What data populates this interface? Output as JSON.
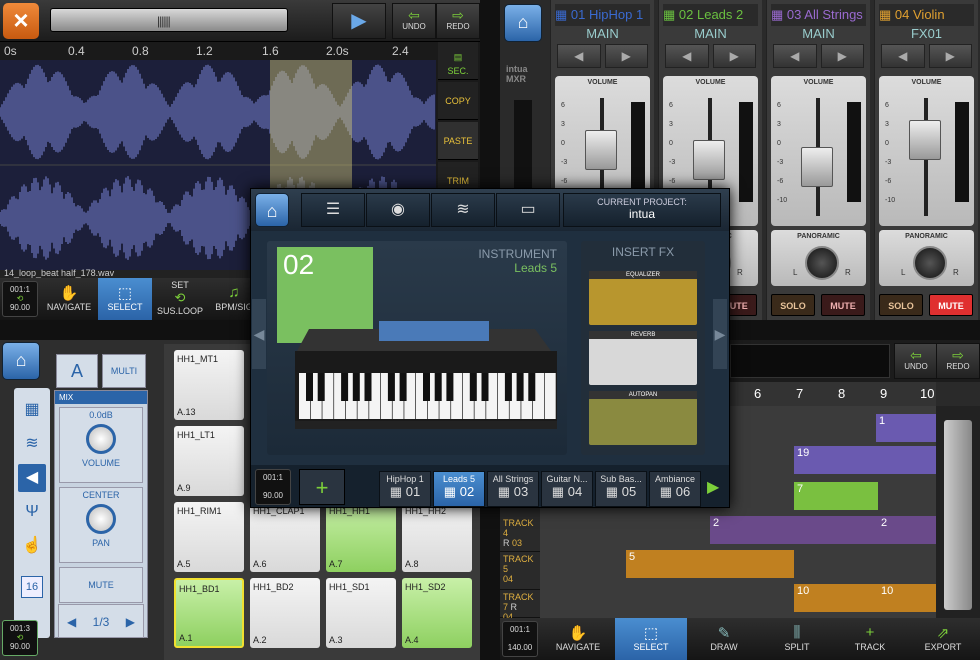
{
  "wave": {
    "close_label": "×",
    "scrubber_label": "||||||",
    "play_label": "▶",
    "undo_label": "UNDO",
    "redo_label": "REDO",
    "ruler": [
      "0s",
      "0.4",
      "0.8",
      "1.2",
      "1.6",
      "2.0s",
      "2.4"
    ],
    "side": {
      "sec": "SEC.",
      "copy": "COPY",
      "paste": "PASTE",
      "trim": "TRIM"
    },
    "filename": "14_loop_beat half_178.wav",
    "pos": {
      "line1": "001:1",
      "line2": "90.00"
    },
    "tools": [
      "NAVIGATE",
      "SELECT",
      "SUS.LOOP",
      "BPM/SIG"
    ],
    "tool_top": {
      "sus_loop": "SET"
    }
  },
  "mixer": {
    "logo": "intua MXR",
    "channels": [
      {
        "name": "01 HipHop 1",
        "bus": "MAIN",
        "color": "#3a6ad0"
      },
      {
        "name": "02 Leads 2",
        "bus": "MAIN",
        "color": "#6ac040"
      },
      {
        "name": "03 All Strings",
        "bus": "MAIN",
        "color": "#9a6ad0"
      },
      {
        "name": "04 Violin",
        "bus": "FX01",
        "color": "#e0a030"
      }
    ],
    "volume_label": "VOLUME",
    "panoramic_label": "PANORAMIC",
    "scale": [
      "6",
      "3",
      "0",
      "-3",
      "-6",
      "-10"
    ],
    "pan_l": "L",
    "pan_r": "R",
    "solo": "SOLO",
    "mute": "MUTE",
    "volume_levels": [
      0.72,
      0.62,
      0.55,
      0.82
    ]
  },
  "drum": {
    "a_label": "A",
    "multi_label": "MULTI",
    "mix_header": "MIX",
    "volume_val": "0.0dB",
    "volume_label": "VOLUME",
    "pan_val": "CENTER",
    "pan_label": "PAN",
    "mute_label": "MUTE",
    "page": "1/3",
    "badge": "16",
    "pos": {
      "line1": "001:3",
      "line2": "90.00"
    },
    "pads": [
      {
        "n": "HH1_MT1",
        "k": "A.13"
      },
      {
        "n": "",
        "k": ""
      },
      {
        "n": "",
        "k": ""
      },
      {
        "n": "",
        "k": ""
      },
      {
        "n": "HH1_LT1",
        "k": "A.9"
      },
      {
        "n": "",
        "k": ""
      },
      {
        "n": "",
        "k": ""
      },
      {
        "n": "",
        "k": ""
      },
      {
        "n": "HH1_RIM1",
        "k": "A.5"
      },
      {
        "n": "HH1_CLAP1",
        "k": "A.6"
      },
      {
        "n": "HH1_HH1",
        "k": "A.7"
      },
      {
        "n": "HH1_HH2",
        "k": "A.8"
      },
      {
        "n": "HH1_BD1",
        "k": "A.1"
      },
      {
        "n": "HH1_BD2",
        "k": "A.2"
      },
      {
        "n": "HH1_SD1",
        "k": "A.3"
      },
      {
        "n": "HH1_SD2",
        "k": "A.4"
      }
    ]
  },
  "seq": {
    "undo_label": "UNDO",
    "redo_label": "REDO",
    "ruler": [
      "6",
      "7",
      "8",
      "9",
      "10"
    ],
    "tracks": [
      {
        "label": "TRACK 4",
        "num": "03"
      },
      {
        "label": "TRACK 4",
        "num": "04"
      },
      {
        "label": "TRACK 5",
        "num": "04"
      },
      {
        "label": "TRACK 7",
        "num": "04"
      }
    ],
    "clips": [
      "1",
      "19",
      "7",
      "2",
      "2",
      "5",
      "10",
      "10"
    ],
    "pos": {
      "line1": "001:1",
      "line2": "140.00"
    },
    "tools": [
      "NAVIGATE",
      "SELECT",
      "DRAW",
      "SPLIT",
      "TRACK",
      "EXPORT"
    ]
  },
  "popup": {
    "project_label": "CURRENT PROJECT:",
    "project_name": "intua",
    "number": "02",
    "instrument_label": "INSTRUMENT",
    "instrument_name": "Leads 5",
    "insert_fx": "INSERT FX",
    "fx": [
      "EQUALIZER",
      "REVERB",
      "AUTOPAN"
    ],
    "pos": {
      "line1": "001:1",
      "line2": "90.00"
    },
    "add": "+",
    "tabs": [
      {
        "name": "HipHop 1",
        "n": "01"
      },
      {
        "name": "Leads 5",
        "n": "02"
      },
      {
        "name": "All Strings",
        "n": "03"
      },
      {
        "name": "Guitar N...",
        "n": "04"
      },
      {
        "name": "Sub Bas...",
        "n": "05"
      },
      {
        "name": "Ambiance",
        "n": "06"
      }
    ]
  }
}
